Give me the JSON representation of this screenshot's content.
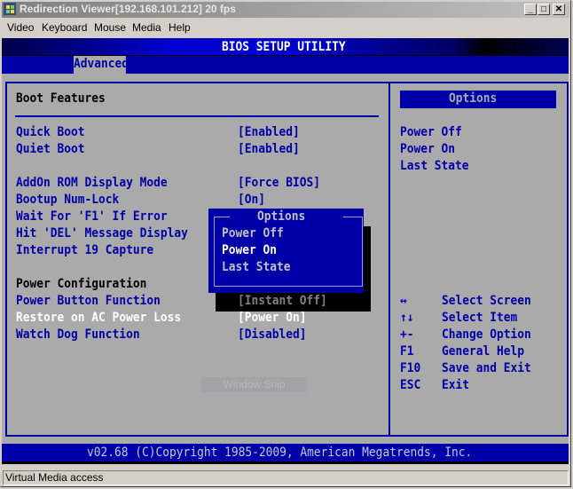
{
  "window": {
    "title": "Redirection Viewer[192.168.101.212]  20 fps",
    "controls": {
      "minimize": "_",
      "maximize": "□",
      "close": "✕"
    }
  },
  "menubar": [
    "Video",
    "Keyboard",
    "Mouse",
    "Media",
    "Help"
  ],
  "bios": {
    "title": "BIOS SETUP UTILITY",
    "active_tab": "Advanced",
    "section_title": "Boot Features",
    "items": [
      {
        "label": "Quick Boot",
        "value": "[Enabled]"
      },
      {
        "label": "Quiet Boot",
        "value": "[Enabled]"
      },
      {
        "label": "AddOn ROM Display Mode",
        "value": "[Force BIOS]"
      },
      {
        "label": "Bootup Num-Lock",
        "value": "[On]"
      },
      {
        "label": "Wait For 'F1' If Error",
        "value": ""
      },
      {
        "label": "Hit 'DEL' Message Display",
        "value": ""
      },
      {
        "label": "Interrupt 19 Capture",
        "value": ""
      }
    ],
    "power_section_title": "Power Configuration",
    "power_items": [
      {
        "label": "Power Button Function",
        "value": "[Instant Off]"
      },
      {
        "label": "Restore on AC Power Loss",
        "value": "[Power On]",
        "selected": true
      },
      {
        "label": "Watch Dog Function",
        "value": "[Disabled]"
      }
    ],
    "popup": {
      "title": "Options",
      "options": [
        "Power Off",
        "Power On",
        "Last State"
      ],
      "highlighted": "Power On"
    },
    "help_panel": {
      "title": "Options",
      "lines": [
        "Power Off",
        "Power On",
        "Last State"
      ]
    },
    "keys": [
      {
        "key": "↔",
        "action": "Select Screen"
      },
      {
        "key": "↑↓",
        "action": "Select Item"
      },
      {
        "key": "+-",
        "action": "Change Option"
      },
      {
        "key": "F1",
        "action": "General Help"
      },
      {
        "key": "F10",
        "action": "Save and Exit"
      },
      {
        "key": "ESC",
        "action": "Exit"
      }
    ],
    "footer": "v02.68 (C)Copyright 1985-2009, American Megatrends, Inc."
  },
  "overlay": {
    "snip_label": "Window Snip"
  },
  "status": "Virtual Media access"
}
